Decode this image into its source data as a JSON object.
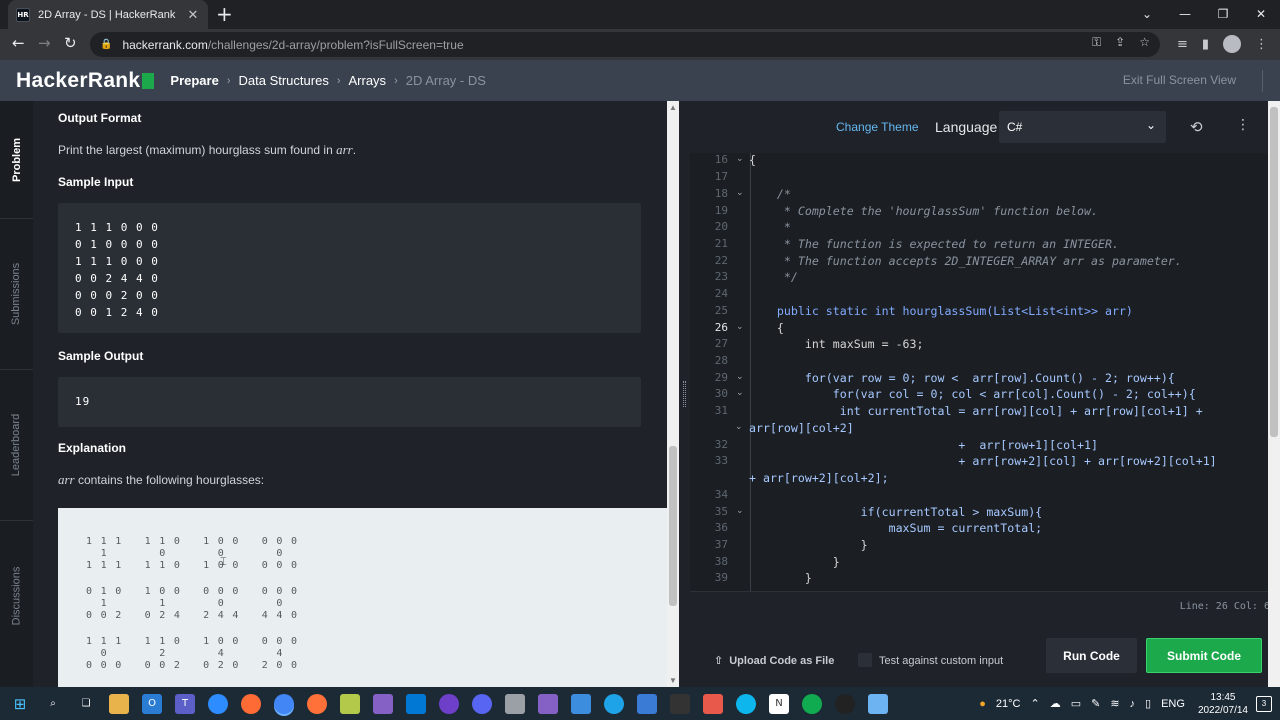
{
  "browser": {
    "tab_title": "2D Array - DS | HackerRank",
    "tab_favicon": "HR",
    "url_host": "hackerrank.com",
    "url_path": "/challenges/2d-array/problem?isFullScreen=true"
  },
  "header": {
    "logo": "HackerRank",
    "breadcrumbs": [
      "Prepare",
      "Data Structures",
      "Arrays",
      "2D Array - DS"
    ],
    "exit_fullscreen": "Exit Full Screen View"
  },
  "side_tabs": [
    "Problem",
    "Submissions",
    "Leaderboard",
    "Discussions"
  ],
  "problem": {
    "output_format_heading": "Output Format",
    "output_format_text": "Print the largest (maximum) hourglass sum found in",
    "output_format_var": "arr",
    "output_format_end": ".",
    "sample_input_heading": "Sample Input",
    "sample_input_lines": [
      "1 1 1 0 0 0",
      "0 1 0 0 0 0",
      "1 1 1 0 0 0",
      "0 0 2 4 4 0",
      "0 0 0 2 0 0",
      "0 0 1 2 4 0"
    ],
    "sample_output_heading": "Sample Output",
    "sample_output": "19",
    "explanation_heading": "Explanation",
    "explanation_var": "arr",
    "explanation_text": " contains the following hourglasses:",
    "hourglass_lines": [
      "1 1 1   1 1 0   1 0 0   0 0 0",
      "  1       0       0       0",
      "1 1 1   1 1 0   1 0 0   0 0 0",
      "",
      "0 1 0   1 0 0   0 0 0   0 0 0",
      "  1       1       0       0",
      "0 0 2   0 2 4   2 4 4   4 4 0",
      "",
      "1 1 1   1 1 0   1 0 0   0 0 0",
      "  0       2       4       4",
      "0 0 0   0 0 2   0 2 0   2 0 0"
    ]
  },
  "editor": {
    "change_theme": "Change Theme",
    "language_label": "Language",
    "language_value": "C#",
    "status": "Line: 26 Col: 6",
    "upload_label": "Upload Code as File",
    "test_custom_label": "Test against custom input",
    "run_label": "Run Code",
    "submit_label": "Submit Code",
    "line_numbers": [
      "16",
      "17",
      "18",
      "19",
      "20",
      "21",
      "22",
      "23",
      "24",
      "25",
      "26",
      "27",
      "28",
      "29",
      "30",
      "31",
      "",
      "32",
      "33",
      "",
      "34",
      "35",
      "36",
      "37",
      "38",
      "39"
    ],
    "active_line": "26",
    "code_lines": [
      "{",
      "",
      "    /*",
      "     * Complete the 'hourglassSum' function below.",
      "     *",
      "     * The function is expected to return an INTEGER.",
      "     * The function accepts 2D_INTEGER_ARRAY arr as parameter.",
      "     */",
      "",
      "    public static int hourglassSum(List<List<int>> arr)",
      "    {",
      "        int maxSum = -63;",
      "",
      "        for(var row = 0; row <  arr[row].Count() - 2; row++){",
      "            for(var col = 0; col < arr[col].Count() - 2; col++){",
      "             int currentTotal = arr[row][col] + arr[row][col+1] +",
      "arr[row][col+2]",
      "                              +  arr[row+1][col+1]",
      "                              + arr[row+2][col] + arr[row+2][col+1]",
      "+ arr[row+2][col+2];",
      "",
      "                if(currentTotal > maxSum){",
      "                    maxSum = currentTotal;",
      "                }",
      "            }",
      "        }"
    ]
  },
  "taskbar": {
    "weather": "21°C",
    "lang": "ENG",
    "time": "13:45",
    "date": "2022/07/14",
    "notifications": "3"
  },
  "colors": {
    "hr_green": "#1ba94c",
    "header_bg": "#39424e",
    "panel_bg": "#1f2329",
    "keyword": "#f07178",
    "function": "#82aaff",
    "comment": "#8a939e"
  }
}
